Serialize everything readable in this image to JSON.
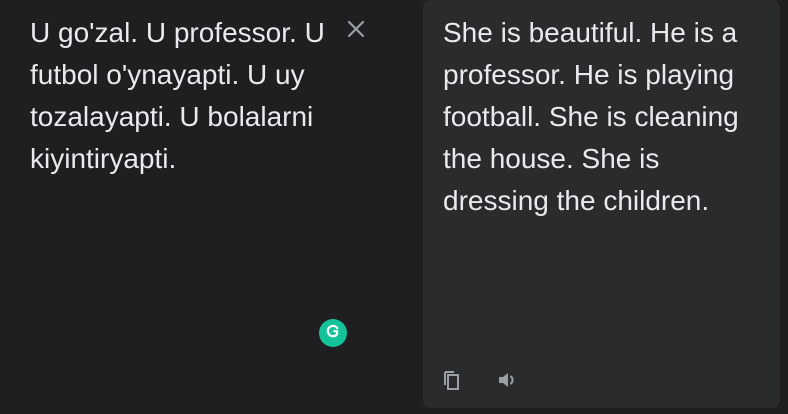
{
  "source": {
    "text": "U go'zal. U professor. U futbol o'ynayapti. U uy tozalayapti. U bolalarni kiyintiryapti.",
    "clear_icon": "close-icon",
    "grammarly_icon": "grammarly-icon",
    "grammarly_color": "#15c39a"
  },
  "translation": {
    "text": "She is beautiful. He is a professor. He is playing football. She is cleaning the house. She is dressing the children.",
    "copy_icon": "copy-icon",
    "listen_icon": "volume-icon"
  },
  "colors": {
    "background": "#1f1f21",
    "panel": "#2a2b2d",
    "text": "#e8eaed",
    "icon": "#9aa0a6"
  }
}
